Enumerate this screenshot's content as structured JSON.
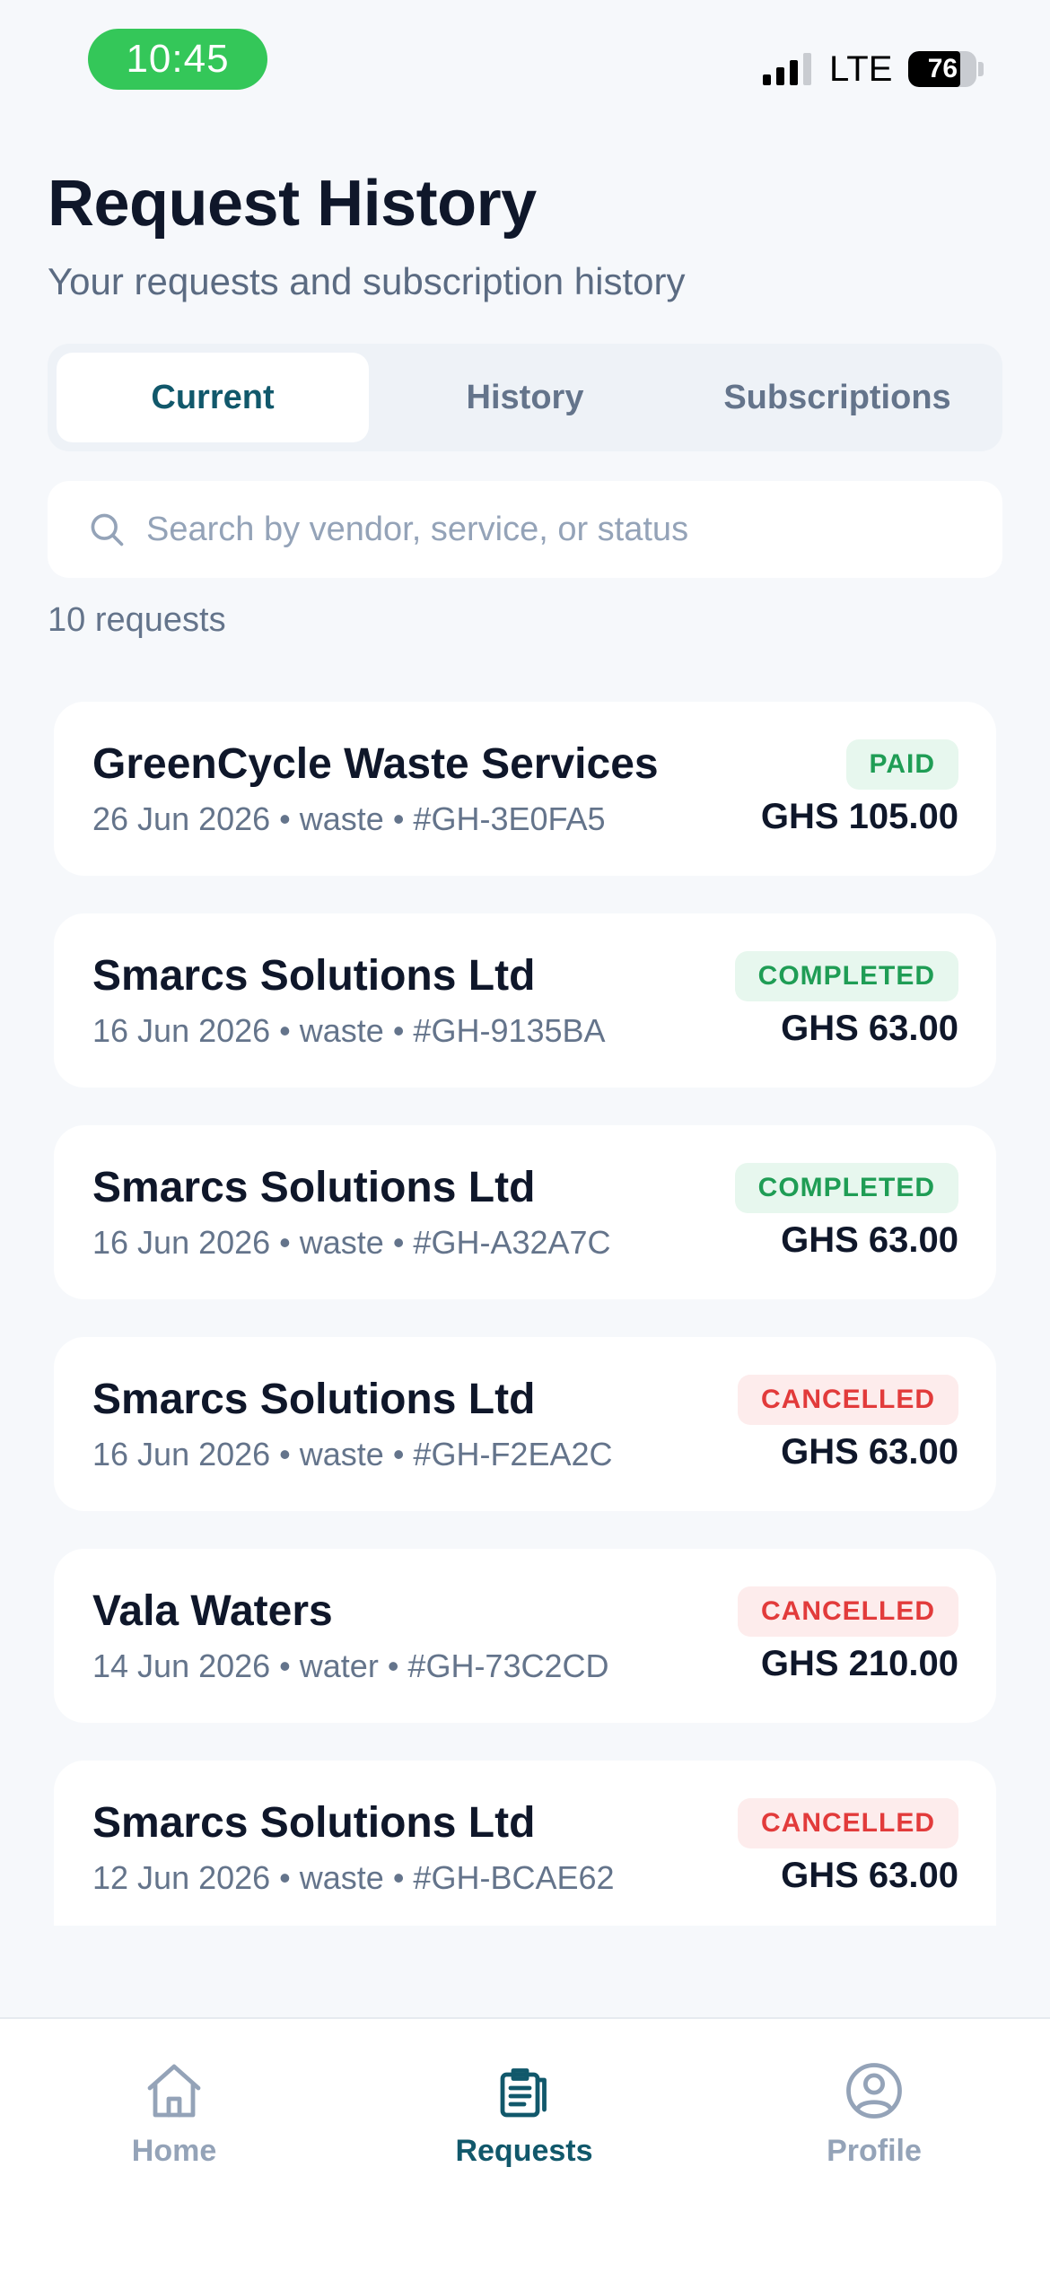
{
  "status_bar": {
    "time": "10:45",
    "network": "LTE",
    "battery": "76",
    "battery_level": 0.76
  },
  "header": {
    "title": "Request History",
    "subtitle": "Your requests and subscription history"
  },
  "tabs": [
    {
      "label": "Current",
      "active": true
    },
    {
      "label": "History",
      "active": false
    },
    {
      "label": "Subscriptions",
      "active": false
    }
  ],
  "search": {
    "placeholder": "Search by vendor, service, or status",
    "value": ""
  },
  "results": {
    "count_label": "10 requests"
  },
  "requests": [
    {
      "vendor": "GreenCycle Waste Services",
      "meta": "26 Jun 2026 • waste • #GH-3E0FA5",
      "status": "PAID",
      "amount": "GHS 105.00"
    },
    {
      "vendor": "Smarcs Solutions Ltd",
      "meta": "16 Jun 2026 • waste • #GH-9135BA",
      "status": "COMPLETED",
      "amount": "GHS 63.00"
    },
    {
      "vendor": "Smarcs Solutions Ltd",
      "meta": "16 Jun 2026 • waste • #GH-A32A7C",
      "status": "COMPLETED",
      "amount": "GHS 63.00"
    },
    {
      "vendor": "Smarcs Solutions Ltd",
      "meta": "16 Jun 2026 • waste • #GH-F2EA2C",
      "status": "CANCELLED",
      "amount": "GHS 63.00"
    },
    {
      "vendor": "Vala Waters",
      "meta": "14 Jun 2026 • water • #GH-73C2CD",
      "status": "CANCELLED",
      "amount": "GHS 210.00"
    },
    {
      "vendor": "Smarcs Solutions Ltd",
      "meta": "12 Jun 2026 • waste • #GH-BCAE62",
      "status": "CANCELLED",
      "amount": "GHS 63.00"
    }
  ],
  "bottom_nav": [
    {
      "label": "Home",
      "icon": "home-icon",
      "active": false
    },
    {
      "label": "Requests",
      "icon": "clipboard-icon",
      "active": true
    },
    {
      "label": "Profile",
      "icon": "profile-icon",
      "active": false
    }
  ],
  "colors": {
    "accent": "#11586B",
    "status_bar_time": "#34C759",
    "success": "#1F9D55",
    "danger": "#E23B3B",
    "background": "#F6F8FB"
  }
}
